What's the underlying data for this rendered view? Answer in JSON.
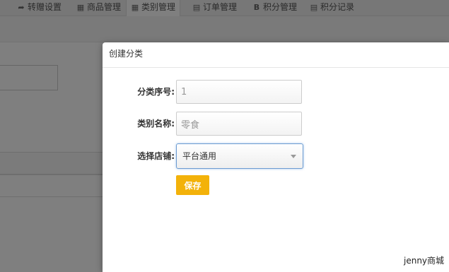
{
  "tabs": [
    {
      "label": "转赠设置",
      "icon": "share-arrow-icon",
      "glyph": "➦"
    },
    {
      "label": "商品管理",
      "icon": "table-icon",
      "glyph": "▦"
    },
    {
      "label": "类别管理",
      "icon": "table-icon",
      "glyph": "▦",
      "active": true
    },
    {
      "label": "订单管理",
      "icon": "document-icon",
      "glyph": "▤"
    },
    {
      "label": "积分管理",
      "icon": "bold-b-icon",
      "glyph": "B"
    },
    {
      "label": "积分记录",
      "icon": "document-icon",
      "glyph": "▤"
    }
  ],
  "modal": {
    "title": "创建分类",
    "fields": {
      "sort_label": "分类序号:",
      "sort_value": "1",
      "name_label": "类别名称:",
      "name_value": "零食",
      "store_label": "选择店铺:",
      "store_selected": "平台通用"
    },
    "save_label": "保存",
    "brand": "jenny商城"
  },
  "colors": {
    "save_button": "#f3b20a",
    "select_focus_border": "#6c9bd1"
  }
}
